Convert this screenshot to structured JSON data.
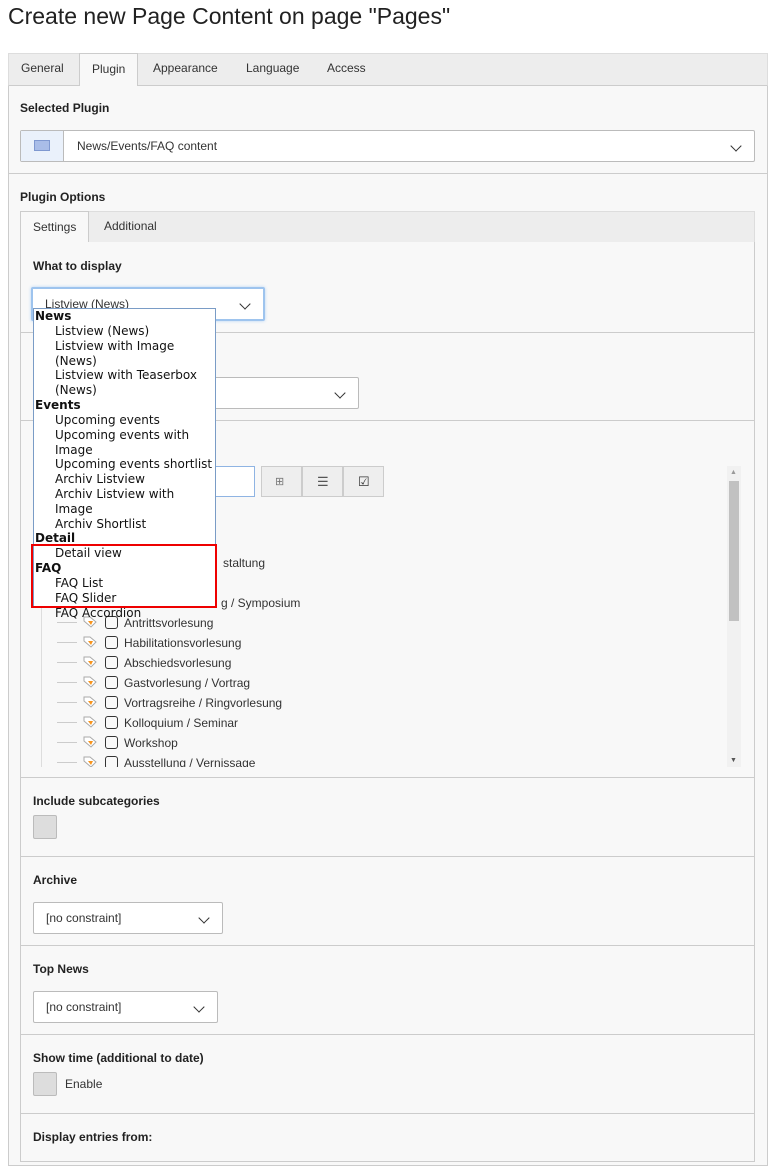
{
  "title": "Create new Page Content on page \"Pages\"",
  "tabs": [
    "General",
    "Plugin",
    "Appearance",
    "Language",
    "Access"
  ],
  "active_tab": "Plugin",
  "selected_plugin": {
    "label": "Selected Plugin",
    "value": "News/Events/FAQ content",
    "icon": "plugin-icon"
  },
  "plugin_options": {
    "label": "Plugin Options",
    "tabs": [
      "Settings",
      "Additional"
    ],
    "active_tab": "Settings"
  },
  "what_to_display": {
    "label": "What to display",
    "value": "Listview (News)"
  },
  "dropdown": {
    "groups": [
      {
        "label": "News",
        "options": [
          "Listview (News)",
          "Listview with Image (News)",
          "Listview with Teaserbox (News)"
        ]
      },
      {
        "label": "Events",
        "options": [
          "Upcoming events",
          "Upcoming events with Image",
          "Upcoming events shortlist",
          "Archiv Listview",
          "Archiv Listview with Image",
          "Archiv Shortlist"
        ]
      },
      {
        "label": "Detail",
        "options": [
          "Detail view"
        ]
      },
      {
        "label": "FAQ",
        "options": [
          "FAQ List",
          "FAQ Slider",
          "FAQ Accordion"
        ]
      }
    ],
    "highlight_color": "#e00000",
    "highlighted_group": "FAQ"
  },
  "category_tree": {
    "toolbar": [
      "tree-icon",
      "list-icon",
      "check-icon"
    ],
    "items": [
      "staltung",
      "",
      "g / Symposium",
      "Antrittsvorlesung",
      "Habilitationsvorlesung",
      "Abschiedsvorlesung",
      "Gastvorlesung / Vortrag",
      "Vortragsreihe / Ringvorlesung",
      "Kolloquium / Seminar",
      "Workshop",
      "Ausstellung / Vernissage"
    ]
  },
  "include_subcategories": {
    "label": "Include subcategories",
    "checked": false
  },
  "archive": {
    "label": "Archive",
    "value": "[no constraint]"
  },
  "top_news": {
    "label": "Top News",
    "value": "[no constraint]"
  },
  "show_time": {
    "label": "Show time (additional to date)",
    "option": "Enable",
    "checked": false
  },
  "display_entries_from": {
    "label": "Display entries from:"
  }
}
